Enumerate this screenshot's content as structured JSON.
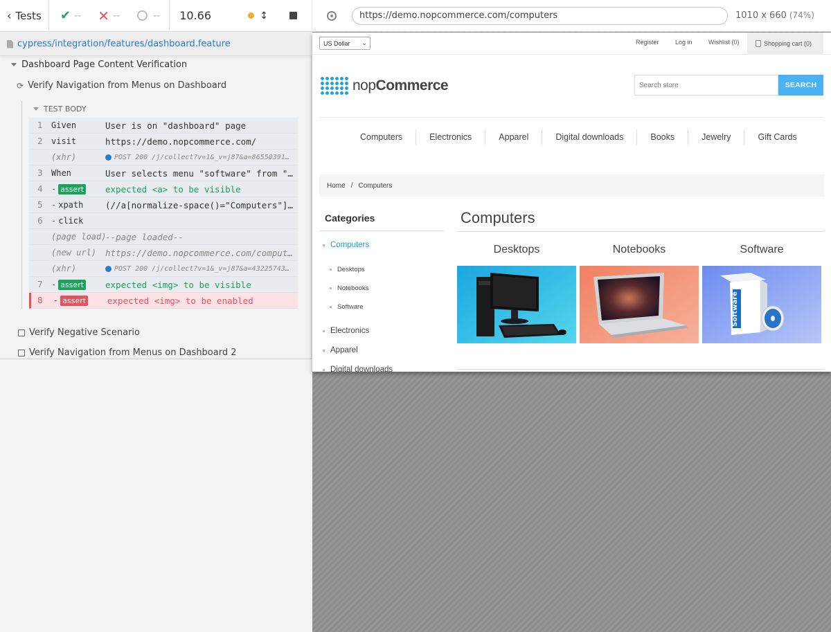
{
  "reporter": {
    "tests_label": "Tests",
    "passed": "--",
    "failed": "--",
    "pending": "--",
    "duration": "10.66",
    "spec_path": "cypress/integration/features/dashboard.feature",
    "suite_title": "Dashboard Page Content Verification",
    "active_test": "Verify Navigation from Menus on Dashboard",
    "test_body_label": "TEST BODY",
    "commands": [
      {
        "num": "1",
        "name": "Given",
        "msg": "User is on \"dashboard\" page"
      },
      {
        "num": "2",
        "name": "visit",
        "msg": "https://demo.nopcommerce.com/"
      },
      {
        "num": "",
        "name": "(xhr)",
        "msg": "POST 200 /j/collect?v=1&_v=j87&a=86550391…"
      },
      {
        "num": "3",
        "name": "When",
        "msg": "User selects menu \"software\" from \"c…"
      },
      {
        "num": "4",
        "name": "assert",
        "msg": "expected <a> to be visible"
      },
      {
        "num": "5",
        "name": "xpath",
        "msg": "(//a[normalize-space()=\"Computers\"])…"
      },
      {
        "num": "6",
        "name": "click",
        "msg": ""
      },
      {
        "num": "",
        "name": "(page load)",
        "msg": "--page loaded--"
      },
      {
        "num": "",
        "name": "(new url)",
        "msg": "https://demo.nopcommerce.com/compute…"
      },
      {
        "num": "",
        "name": "(xhr)",
        "msg": "POST 200 /j/collect?v=1&_v=j87&a=43225743…"
      },
      {
        "num": "7",
        "name": "assert",
        "msg": "expected <img> to be visible"
      },
      {
        "num": "8",
        "name": "assert",
        "msg": "expected <img> to be enabled"
      }
    ],
    "other_tests": [
      "Verify Negative Scenario",
      "Verify Navigation from Menus on Dashboard 2"
    ]
  },
  "browser": {
    "url": "https://demo.nopcommerce.com/computers",
    "viewport": "1010 x 660",
    "zoom": "(74%)"
  },
  "site": {
    "currency": "US Dollar",
    "links": {
      "register": "Register",
      "login": "Log in",
      "wishlist": "Wishlist (0)",
      "cart": "Shopping cart (0)"
    },
    "logo_light": "nop",
    "logo_bold": "Commerce",
    "search_placeholder": "Search store",
    "search_button": "SEARCH",
    "nav": [
      "Computers",
      "Electronics",
      "Apparel",
      "Digital downloads",
      "Books",
      "Jewelry",
      "Gift Cards"
    ],
    "breadcrumb": {
      "home": "Home",
      "sep": "/",
      "current": "Computers"
    },
    "categories_title": "Categories",
    "categories": {
      "computers": "Computers",
      "desktops": "Desktops",
      "notebooks": "Notebooks",
      "software": "Software",
      "electronics": "Electronics",
      "apparel": "Apparel",
      "digital": "Digital downloads"
    },
    "page_title": "Computers",
    "subcategories": [
      "Desktops",
      "Notebooks",
      "Software"
    ],
    "software_box_text": "Software"
  },
  "colors": {
    "pass": "#23a567",
    "fail": "#e05561",
    "link": "#2a7bd5",
    "nop_blue": "#1fa4d9",
    "search_btn": "#4ab2f1"
  }
}
